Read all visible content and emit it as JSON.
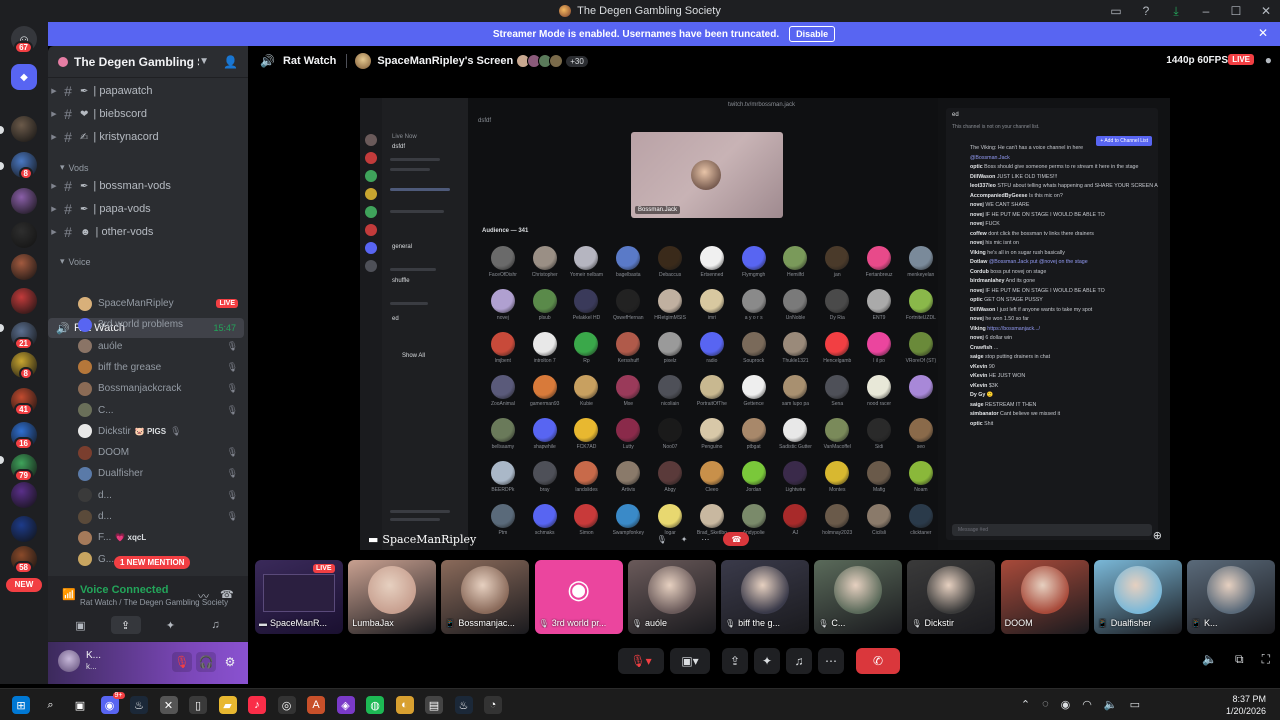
{
  "window": {
    "title": "The Degen Gambling Society"
  },
  "banner": {
    "text": "Streamer Mode is enabled. Usernames have been truncated.",
    "action": "Disable"
  },
  "rail": {
    "home_badge": "67",
    "servers": [
      {
        "color": "#6b5a4a",
        "badge": ""
      },
      {
        "color": "#4a78c2",
        "badge": "8"
      },
      {
        "color": "#8a5fa8",
        "badge": ""
      },
      {
        "color": "#2e2e2e",
        "badge": ""
      },
      {
        "color": "#a25a3f",
        "badge": ""
      },
      {
        "color": "#c23b3b",
        "badge": ""
      },
      {
        "color": "#5a6e8e",
        "badge": "21"
      },
      {
        "color": "#c8a530",
        "badge": "8"
      },
      {
        "color": "#c24b2f",
        "badge": "41"
      },
      {
        "color": "#2f6fd1",
        "badge": "16"
      },
      {
        "color": "#3fa35b",
        "badge": "79"
      },
      {
        "color": "#5a2f8a",
        "badge": ""
      },
      {
        "color": "#1d3b8a",
        "badge": ""
      },
      {
        "color": "#8a4a2a",
        "badge": "58"
      }
    ],
    "new_label": "NEW"
  },
  "sidebar": {
    "guild_name": "The Degen Gambling So...",
    "channels_top": [
      {
        "name": "papawatch",
        "emoji": "✒"
      },
      {
        "name": "biebscord",
        "emoji": "❤"
      },
      {
        "name": "kristynacord",
        "emoji": "✍"
      }
    ],
    "vods_category": "Vods",
    "vod_channels": [
      {
        "name": "bossman-vods",
        "emoji": "✒"
      },
      {
        "name": "papa-vods",
        "emoji": "✒"
      },
      {
        "name": "other-vods",
        "emoji": "☻"
      }
    ],
    "voice_category": "Voice",
    "voice_channel": {
      "name": "Rat Watch",
      "time": "15:47"
    },
    "voice_users": [
      {
        "name": "SpaceManRipley",
        "color": "#d8b07a",
        "live": "LIVE",
        "tag": ""
      },
      {
        "name": "3rd world problems",
        "color": "#5865f2",
        "live": "",
        "tag": ""
      },
      {
        "name": "auóle",
        "color": "#8a7466",
        "live": "",
        "tag": ""
      },
      {
        "name": "biff the grease",
        "color": "#b5773a",
        "live": "",
        "tag": ""
      },
      {
        "name": "Bossmanjackcrack",
        "color": "#8b6b55",
        "live": "",
        "tag": ""
      },
      {
        "name": "C...",
        "color": "#6a6f59",
        "live": "",
        "tag": ""
      },
      {
        "name": "Dickstir",
        "color": "#e8e8e8",
        "live": "",
        "tag": "🐷 PIGS"
      },
      {
        "name": "DOOM",
        "color": "#7a3e2e",
        "live": "",
        "tag": ""
      },
      {
        "name": "Dualfisher",
        "color": "#5a7aa8",
        "live": "",
        "tag": ""
      },
      {
        "name": "d...",
        "color": "#3a3a3a",
        "live": "",
        "tag": ""
      },
      {
        "name": "d...",
        "color": "#5a4a3a",
        "live": "",
        "tag": ""
      },
      {
        "name": "F...",
        "color": "#a57a5a",
        "live": "",
        "tag": "💗 xqcL"
      },
      {
        "name": "G...",
        "color": "#c8a560",
        "live": "",
        "tag": ""
      }
    ],
    "mention_pill": "1 NEW MENTION",
    "voice_panel": {
      "status": "Voice Connected",
      "location": "Rat Watch / The Degen Gambling Society"
    },
    "user": {
      "name": "K...",
      "status": "k..."
    }
  },
  "stream": {
    "channel": "Rat Watch",
    "screen_title": "SpaceManRipley's Screen",
    "viewer_more": "+30",
    "quality": "1440p 60FPS",
    "live": "LIVE",
    "streamer_tag": "SpaceManRipley"
  },
  "inner": {
    "channel_label": "dsfdf",
    "tab_label": "twitch.tv/mrbossman.jack",
    "cam_label": "Bossman.Jack",
    "audience_header": "Audience — 341",
    "sidebar_labels": [
      "Live Now",
      "dsfdf",
      "general",
      "shuffle",
      "ed",
      "Show All"
    ],
    "audience": [
      {
        "n": "FaceOfDishr",
        "c": "#6a6a6a"
      },
      {
        "n": "Christopher",
        "c": "#9a8f85"
      },
      {
        "n": "Yomeir nelbam",
        "c": "#b5b5c0"
      },
      {
        "n": "bagelbasta",
        "c": "#5a7ac8"
      },
      {
        "n": "Debaccus",
        "c": "#3a2a1a"
      },
      {
        "n": "Ertsenned",
        "c": "#f0f0f0"
      },
      {
        "n": "Flymgmgh",
        "c": "#5865f2"
      },
      {
        "n": "Hemilfd",
        "c": "#7a9a5a"
      },
      {
        "n": "jan",
        "c": "#4a3a2a"
      },
      {
        "n": "Fertanbreuz",
        "c": "#e84a8a"
      },
      {
        "n": "menkeyelan",
        "c": "#7a8a9a"
      },
      {
        "n": "novej",
        "c": "#b0a0d0"
      },
      {
        "n": "plsub",
        "c": "#5a8a4a"
      },
      {
        "n": "Pelakkel HD",
        "c": "#3a3a5a"
      },
      {
        "n": "QswefHernan",
        "c": "#222222"
      },
      {
        "n": "HRetgimMSIS",
        "c": "#c0b0a0"
      },
      {
        "n": "imri",
        "c": "#d8c8a0"
      },
      {
        "n": "a y o r s",
        "c": "#8a8a8a"
      },
      {
        "n": "UnNoble",
        "c": "#7a7a7a"
      },
      {
        "n": "Dy Ria",
        "c": "#4a4a4a"
      },
      {
        "n": "ENT9",
        "c": "#aaaaaa"
      },
      {
        "n": "FortniteUZDL",
        "c": "#8ab84a"
      },
      {
        "n": "lmjbent",
        "c": "#c84a3a"
      },
      {
        "n": "introlton 7",
        "c": "#e8e8e8"
      },
      {
        "n": "Rp",
        "c": "#3aa84a"
      },
      {
        "n": "Kersshuff",
        "c": "#b05a4a"
      },
      {
        "n": "pixelz",
        "c": "#9a9a9a"
      },
      {
        "n": "radio",
        "c": "#5865f2"
      },
      {
        "n": "Souprock",
        "c": "#7a6a5a"
      },
      {
        "n": "Thukle1321",
        "c": "#9a8a7a"
      },
      {
        "n": "Hencelgamb",
        "c": "#f23f43"
      },
      {
        "n": "l il po",
        "c": "#eb459e"
      },
      {
        "n": "VRoreOf (ST)",
        "c": "#6a8a3a"
      },
      {
        "n": "ZooAnimal",
        "c": "#5a5a7a"
      },
      {
        "n": "gamerman93",
        "c": "#d87a3a"
      },
      {
        "n": "Kubie",
        "c": "#c8a060"
      },
      {
        "n": "Mxe",
        "c": "#9a3a5a"
      },
      {
        "n": "nicoliain",
        "c": "#4e5058"
      },
      {
        "n": "PortraitOfThe",
        "c": "#c8b890"
      },
      {
        "n": "Gettence",
        "c": "#eeeeee"
      },
      {
        "n": "sam lupo pa",
        "c": "#a89070"
      },
      {
        "n": "Sena",
        "c": "#4e5058"
      },
      {
        "n": "nood racer",
        "c": "#e8e8d8"
      },
      {
        "n": "",
        "c": "#a888d8"
      },
      {
        "n": "bellsaamy",
        "c": "#6a7a5a"
      },
      {
        "n": "shapwhile",
        "c": "#5865f2"
      },
      {
        "n": "FCK7AD",
        "c": "#e8b830"
      },
      {
        "n": "Lutty",
        "c": "#8a2a4a"
      },
      {
        "n": "Noo07",
        "c": "#1a1a1a"
      },
      {
        "n": "Penguino",
        "c": "#d8c8a8"
      },
      {
        "n": "ptbgat",
        "c": "#a8886a"
      },
      {
        "n": "Sadistic Gutter",
        "c": "#e8e8e8"
      },
      {
        "n": "VanMacoffel",
        "c": "#7a8a5a"
      },
      {
        "n": "Sidi",
        "c": "#2a2a2a"
      },
      {
        "n": "seo",
        "c": "#8a6a4a"
      },
      {
        "n": "BEERDPk",
        "c": "#aab8c8"
      },
      {
        "n": "bray",
        "c": "#4e5058"
      },
      {
        "n": "landslides",
        "c": "#c86a4a"
      },
      {
        "n": "Artivis",
        "c": "#8a7a6a"
      },
      {
        "n": "Abgy",
        "c": "#5a3a3a"
      },
      {
        "n": "Cleeo",
        "c": "#c8904a"
      },
      {
        "n": "Jordan",
        "c": "#7ac83a"
      },
      {
        "n": "Lightwire",
        "c": "#3a2a4a"
      },
      {
        "n": "Montes",
        "c": "#d8b830"
      },
      {
        "n": "Mafig",
        "c": "#6a5a4a"
      },
      {
        "n": "Noam",
        "c": "#8ab83a"
      },
      {
        "n": "Ptm",
        "c": "#5a6a7a"
      },
      {
        "n": "schmaks",
        "c": "#5865f2"
      },
      {
        "n": "Simon",
        "c": "#c83a3a"
      },
      {
        "n": "Swampfonkey",
        "c": "#3a8ac8"
      },
      {
        "n": "Iogar",
        "c": "#e8d870"
      },
      {
        "n": "Brad_Sketlbo",
        "c": "#c8b8a0"
      },
      {
        "n": "Andypolie",
        "c": "#7a8a6a"
      },
      {
        "n": "AJ",
        "c": "#a82a2a"
      },
      {
        "n": "holmnay2023",
        "c": "#6a5a4a"
      },
      {
        "n": "Cicilsli",
        "c": "#8a7a6a"
      },
      {
        "n": "clicktaner",
        "c": "#2a3a4a"
      }
    ],
    "chat_header": "ed",
    "chat_notice": "This channel is not on your channel list.",
    "chat_add": "+ Add to Channel List",
    "chat": [
      {
        "u": "",
        "t": "The Viking: He can't has a voice channel in here"
      },
      {
        "u": "",
        "t": "@Bossman.Jack"
      },
      {
        "u": "optic",
        "t": "Boss should give someone perms to re stream it here in the stage"
      },
      {
        "u": "DillWason",
        "t": "JUST LIKE OLD TIMES!!!"
      },
      {
        "u": "leot337leo",
        "t": "STFU about telling whats happening and SHARE YOUR SCREEN ARE YOU RESTARTED?"
      },
      {
        "u": "AccompaniedByGeese",
        "t": "Is this mic on?"
      },
      {
        "u": "novej",
        "t": "WE CANT SHARE"
      },
      {
        "u": "novej",
        "t": "IF HE PUT ME ON STAGE I WOULD BE ABLE TO"
      },
      {
        "u": "novej",
        "t": "FUCK"
      },
      {
        "u": "coffew",
        "t": "dont click the bossman tv links there drainers"
      },
      {
        "u": "novej",
        "t": "his mic isnt on"
      },
      {
        "u": "Viking",
        "t": "he's all in on sugar rush basically"
      },
      {
        "u": "Dotlaw",
        "t": "@Bossman.Jack put @novej on the stage"
      },
      {
        "u": "Cordub",
        "t": "boss put novej on stage"
      },
      {
        "u": "birdmanlahey",
        "t": "And its gone"
      },
      {
        "u": "novej",
        "t": "IF HE PUT ME ON STAGE I WOULD BE ABLE TO"
      },
      {
        "u": "optic",
        "t": "GET ON STAGE PUSSY"
      },
      {
        "u": "DillWason",
        "t": "I just left if anyone wants to take my spot"
      },
      {
        "u": "novej",
        "t": "he won 1.50 so far"
      },
      {
        "u": "Viking",
        "t": "https://bossmanjack.../"
      },
      {
        "u": "novej",
        "t": "6 dollar win"
      },
      {
        "u": "Crawfish",
        "t": "..."
      },
      {
        "u": "saige",
        "t": "stop putting drainers in chat"
      },
      {
        "u": "vKevin",
        "t": "90"
      },
      {
        "u": "vKevin",
        "t": "HE JUST WON"
      },
      {
        "u": "vKevin",
        "t": "$3K"
      },
      {
        "u": "Dy Gy",
        "t": "🙂"
      },
      {
        "u": "saige",
        "t": "RESTREAM IT THEN"
      },
      {
        "u": "simbanator",
        "t": "Cant believe we missed it"
      },
      {
        "u": "optic",
        "t": "Shit"
      }
    ],
    "chat_input": "Message #ed"
  },
  "tiles": [
    {
      "label": "SpaceManR...",
      "color": "#2a1a3a",
      "live": "LIVE",
      "icon": "screen"
    },
    {
      "label": "LumbaJax",
      "color": "#c8a090",
      "live": "",
      "icon": ""
    },
    {
      "label": "Bossmanjac...",
      "color": "#8a6a5a",
      "live": "",
      "icon": "phone"
    },
    {
      "label": "3rd world pr...",
      "color": "#eb459e",
      "live": "",
      "icon": "mute"
    },
    {
      "label": "auóle",
      "color": "#6a5a5a",
      "live": "",
      "icon": "mute"
    },
    {
      "label": "biff the g...",
      "color": "#3a3a4a",
      "live": "",
      "icon": "mute"
    },
    {
      "label": "C...",
      "color": "#5a6a5a",
      "live": "",
      "icon": "mute"
    },
    {
      "label": "Dickstir",
      "color": "#3a3a3a",
      "live": "",
      "icon": "mute"
    },
    {
      "label": "DOOM",
      "color": "#a84a3a",
      "live": "",
      "icon": ""
    },
    {
      "label": "Dualfisher",
      "color": "#7ab8d8",
      "live": "",
      "icon": "phone"
    },
    {
      "label": "K...",
      "color": "#5a6a7a",
      "live": "",
      "icon": "phone"
    }
  ],
  "taskbar": {
    "time": "8:37 PM",
    "date": "1/20/2026",
    "discord_badge": "9+"
  }
}
